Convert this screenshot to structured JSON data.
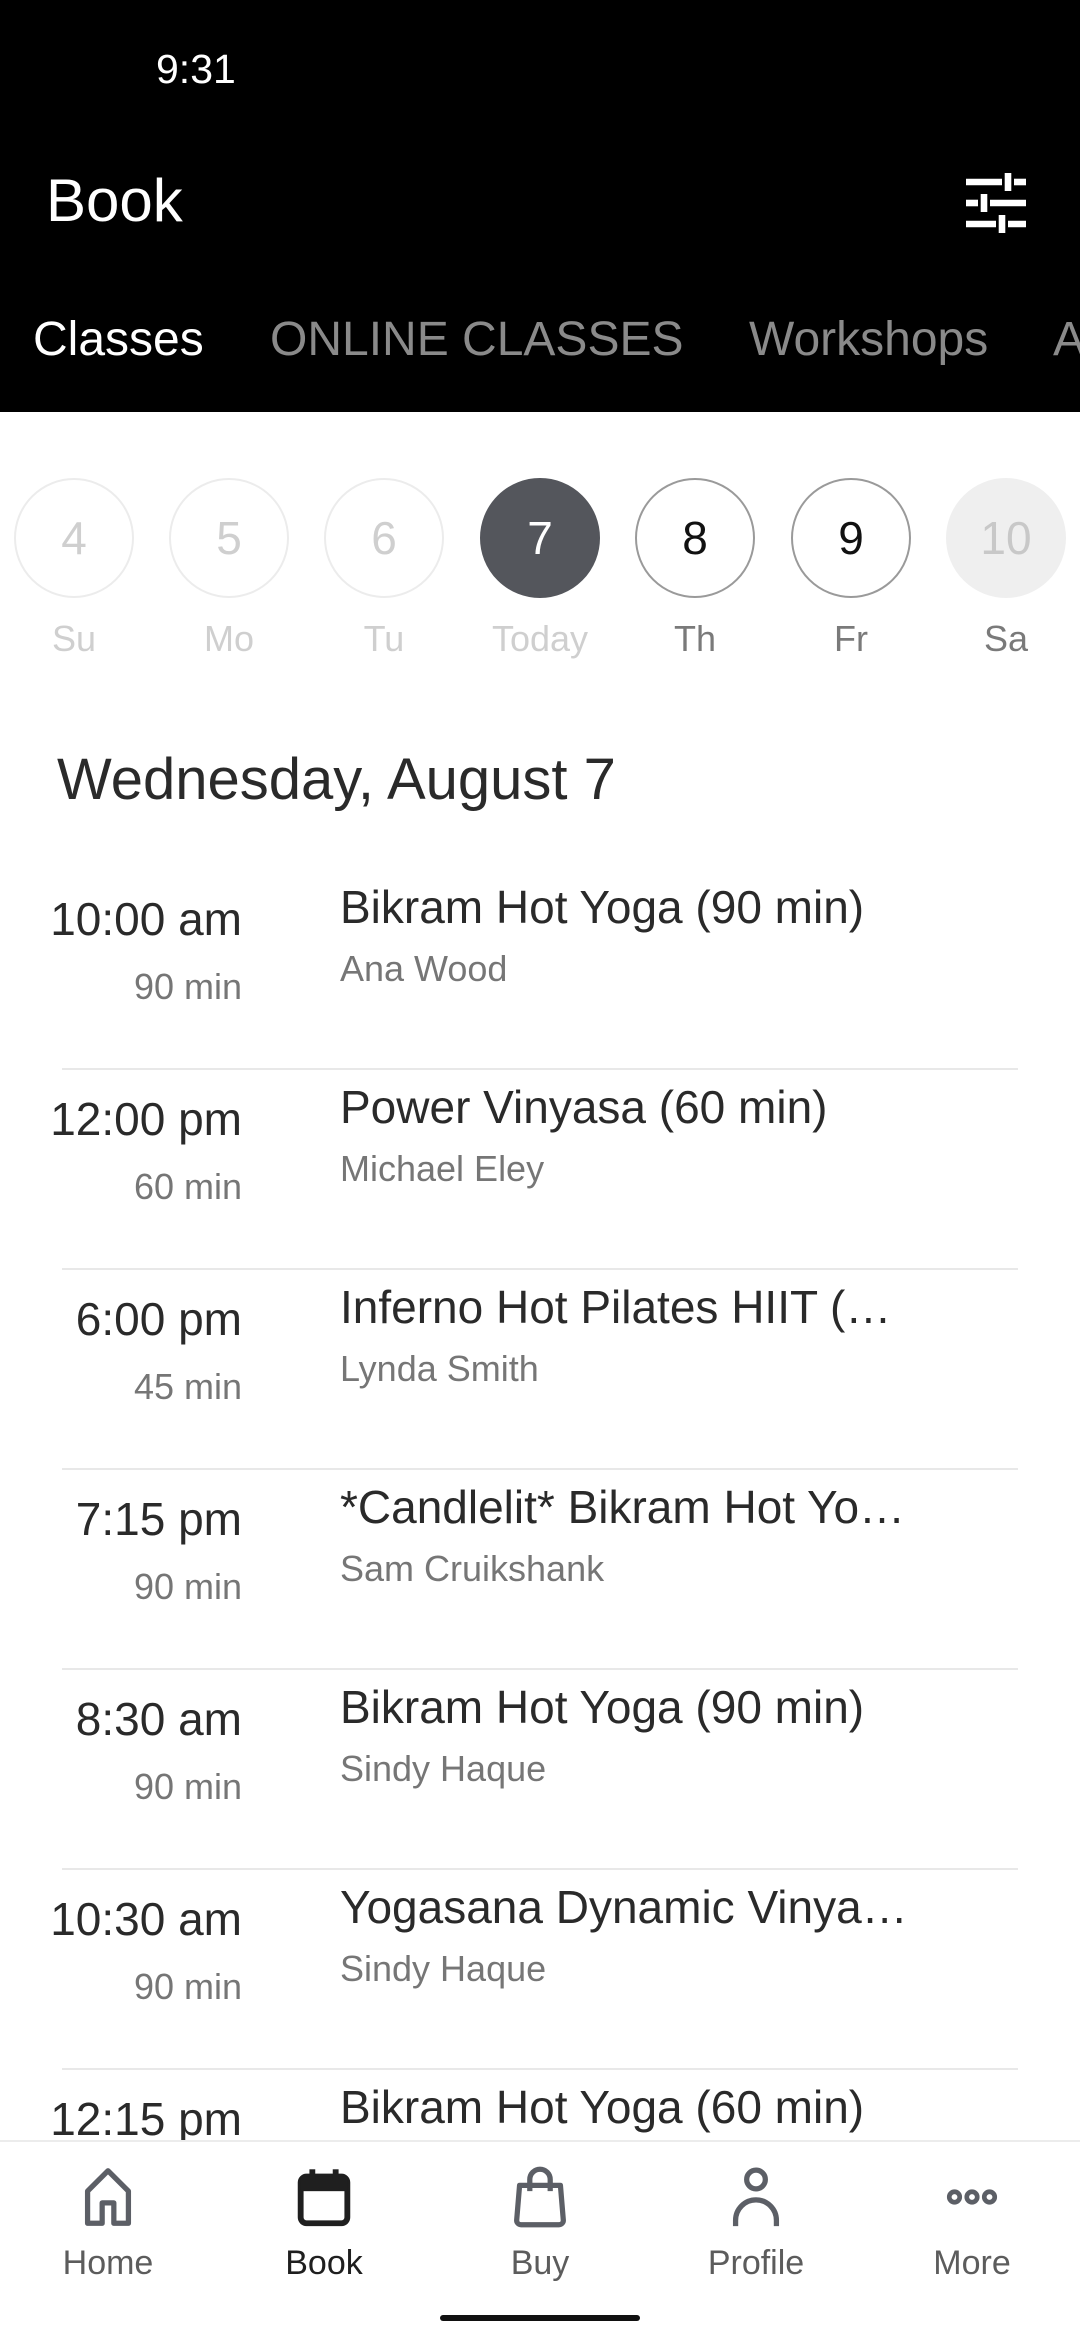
{
  "status_bar": {
    "time": "9:31"
  },
  "header": {
    "title": "Book",
    "filter_icon": "tune-sliders-icon"
  },
  "tabs": [
    {
      "label": "Classes",
      "active": true
    },
    {
      "label": "ONLINE CLASSES",
      "active": false
    },
    {
      "label": "Workshops",
      "active": false
    },
    {
      "label": "A",
      "active": false
    }
  ],
  "dates": [
    {
      "num": "4",
      "day": "Su",
      "state": "past"
    },
    {
      "num": "5",
      "day": "Mo",
      "state": "past"
    },
    {
      "num": "6",
      "day": "Tu",
      "state": "past"
    },
    {
      "num": "7",
      "day": "Today",
      "state": "selected"
    },
    {
      "num": "8",
      "day": "Th",
      "state": "future"
    },
    {
      "num": "9",
      "day": "Fr",
      "state": "future"
    },
    {
      "num": "10",
      "day": "Sa",
      "state": "disabled"
    }
  ],
  "day_heading": "Wednesday, August 7",
  "classes": [
    {
      "time": "10:00 am",
      "duration": "90 min",
      "name": "Bikram Hot Yoga (90 min)",
      "instructor": "Ana Wood"
    },
    {
      "time": "12:00 pm",
      "duration": "60 min",
      "name": "Power Vinyasa (60 min)",
      "instructor": "Michael Eley"
    },
    {
      "time": "6:00 pm",
      "duration": "45 min",
      "name": "Inferno Hot Pilates HIIT (…",
      "instructor": "Lynda Smith"
    },
    {
      "time": "7:15 pm",
      "duration": "90 min",
      "name": "*Candlelit* Bikram Hot Yo…",
      "instructor": "Sam Cruikshank"
    },
    {
      "time": "8:30 am",
      "duration": "90 min",
      "name": "Bikram Hot Yoga (90 min)",
      "instructor": "Sindy Haque"
    },
    {
      "time": "10:30 am",
      "duration": "90 min",
      "name": "Yogasana Dynamic Vinya…",
      "instructor": "Sindy Haque"
    },
    {
      "time": "12:15 pm",
      "duration": "",
      "name": "Bikram Hot Yoga (60 min)",
      "instructor": ""
    }
  ],
  "bottom_nav": [
    {
      "label": "Home",
      "icon": "home-icon",
      "active": false
    },
    {
      "label": "Book",
      "icon": "calendar-icon",
      "active": true
    },
    {
      "label": "Buy",
      "icon": "shopping-bag-icon",
      "active": false
    },
    {
      "label": "Profile",
      "icon": "person-icon",
      "active": false
    },
    {
      "label": "More",
      "icon": "more-dots-icon",
      "active": false
    }
  ]
}
